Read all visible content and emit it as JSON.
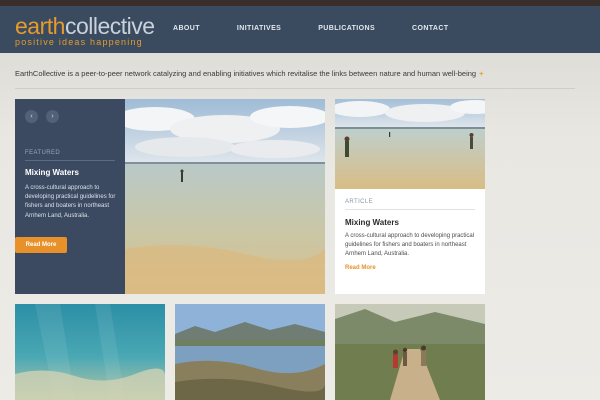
{
  "brand": {
    "name_part1": "earth",
    "name_part2": "collective",
    "tagline": "positive ideas happening"
  },
  "nav": {
    "items": [
      {
        "label": "ABOUT"
      },
      {
        "label": "INITIATIVES"
      },
      {
        "label": "PUBLICATIONS"
      },
      {
        "label": "CONTACT"
      }
    ]
  },
  "intro": {
    "text": "EarthCollective is a peer-to-peer network catalyzing and enabling initiatives which revitalise the links between nature and human well-being",
    "more": "+"
  },
  "featured": {
    "prev_icon": "‹",
    "next_icon": "›",
    "label": "FEATURED",
    "title": "Mixing Waters",
    "description": "A cross-cultural approach to developing practical guidelines for fishers and boaters in northeast Arnhem Land, Australia.",
    "button": "Read More"
  },
  "article": {
    "label": "ARTICLE",
    "title": "Mixing Waters",
    "description": "A cross-cultural approach to developing practical guidelines for fishers and boaters in northeast Arnhem Land, Australia.",
    "more": "Read More"
  },
  "colors": {
    "accent": "#e8912a",
    "header": "#3a4a5f",
    "panel": "#3b4a60"
  },
  "images": [
    {
      "name": "hero-beach-photo"
    },
    {
      "name": "article-beach-photo"
    },
    {
      "name": "underwater-sand-photo"
    },
    {
      "name": "lake-mountains-photo"
    },
    {
      "name": "hikers-trail-photo"
    }
  ]
}
